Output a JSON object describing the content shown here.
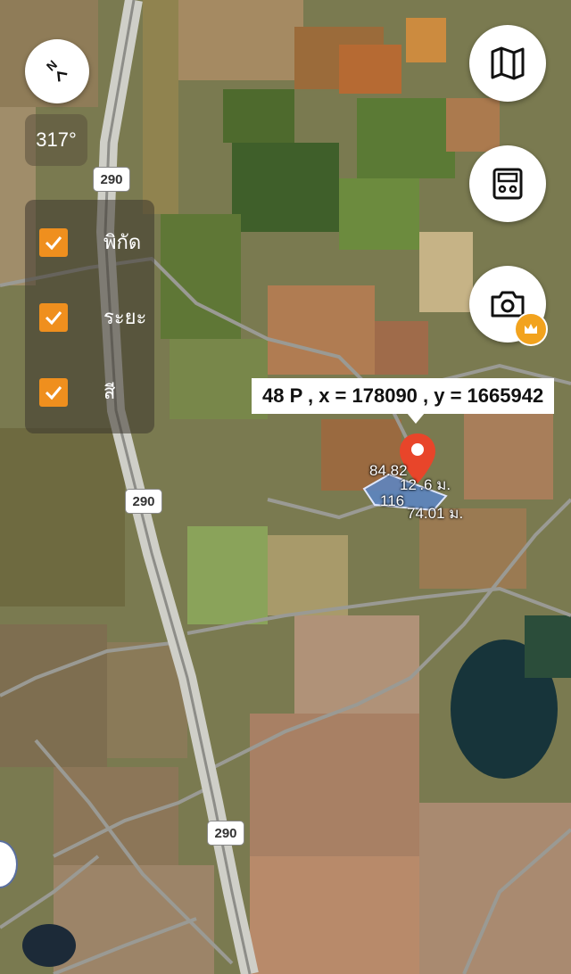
{
  "compass": {
    "icon": "compass-north-icon",
    "heading": "317°"
  },
  "layers": [
    {
      "label": "พิกัด",
      "checked": true
    },
    {
      "label": "ระยะ",
      "checked": true
    },
    {
      "label": "สี",
      "checked": true
    }
  ],
  "buttons": {
    "map_type": {
      "icon": "map-icon"
    },
    "measure": {
      "icon": "surveyor-device-icon"
    },
    "camera": {
      "icon": "camera-icon",
      "badge_icon": "crown-icon"
    }
  },
  "marker": {
    "coordinate_label": "48 P , x = 178090 , y = 1665942",
    "dimensions": {
      "side_left": "84.82",
      "side_top": "12 .6 ม.",
      "side_bottom_left": "116",
      "side_bottom": "74.01 ม."
    }
  },
  "road_shields": [
    "290",
    "290",
    "290"
  ],
  "colors": {
    "accent": "#ef8f1e",
    "marker": "#e8452a",
    "parcel": "#5a86c8"
  }
}
